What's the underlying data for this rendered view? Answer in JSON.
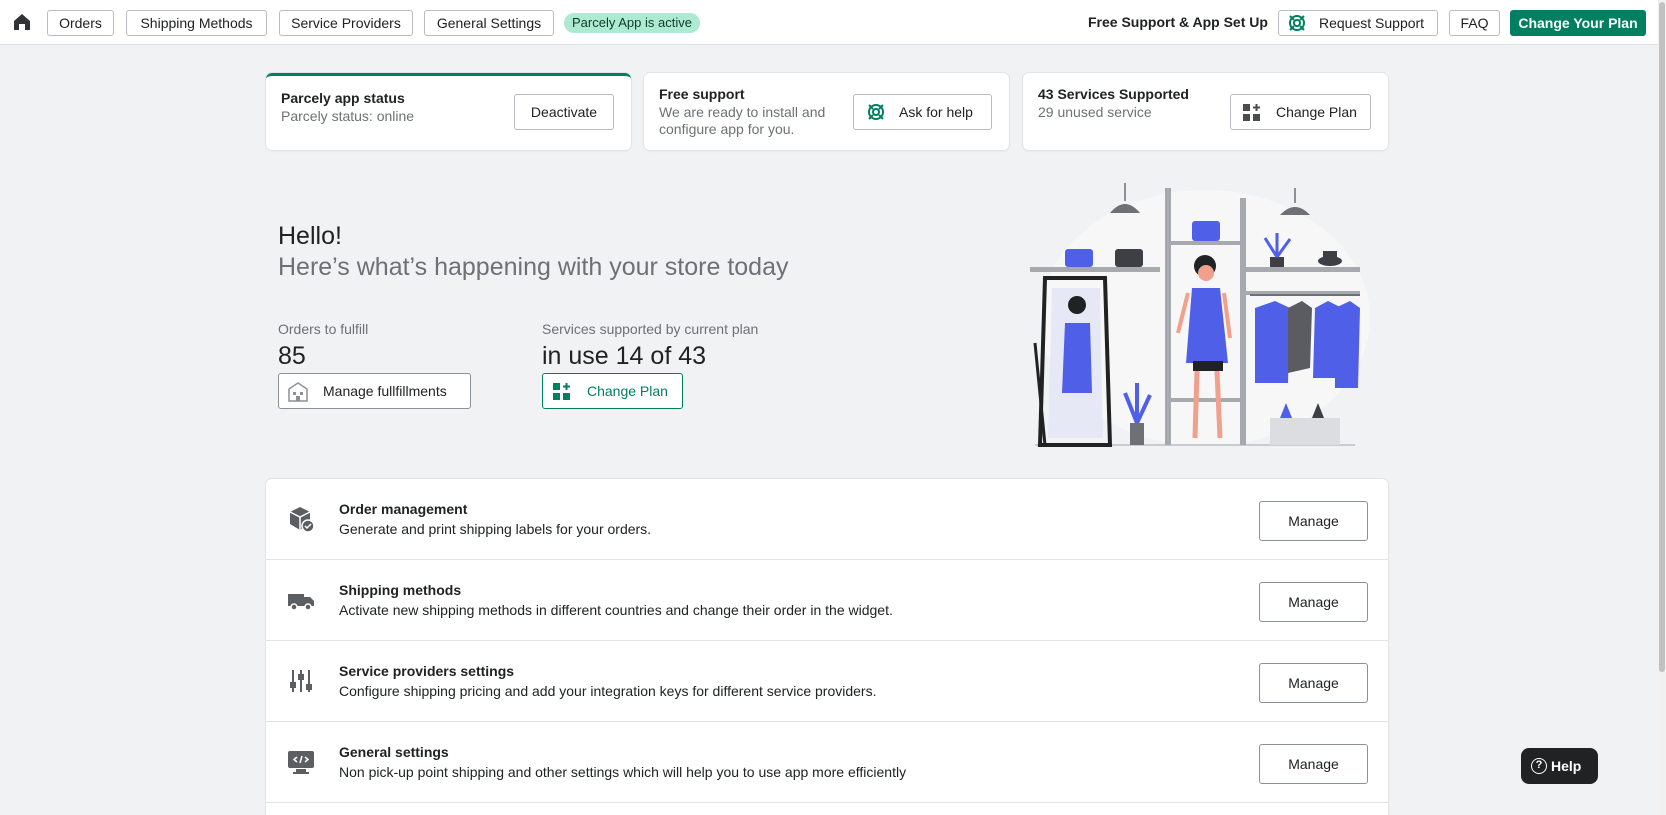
{
  "topbar": {
    "nav": [
      "Orders",
      "Shipping Methods",
      "Service Providers",
      "General Settings"
    ],
    "status_badge": "Parcely App is active",
    "support_label": "Free Support & App Set Up",
    "request_support": "Request Support",
    "faq": "FAQ",
    "change_plan": "Change Your Plan"
  },
  "cards": {
    "status": {
      "title": "Parcely app status",
      "subtitle": "Parcely status: online",
      "button": "Deactivate"
    },
    "support": {
      "title": "Free support",
      "subtitle_line1": "We are ready to install and",
      "subtitle_line2": "configure app for you.",
      "button": "Ask for help"
    },
    "services": {
      "title": "43 Services Supported",
      "subtitle": "29 unused service",
      "button": "Change Plan"
    }
  },
  "hero": {
    "greeting": "Hello!",
    "subtitle": "Here’s what’s happening with your store today",
    "orders_label": "Orders to fulfill",
    "orders_value": "85",
    "orders_button": "Manage fullfillments",
    "services_label": "Services supported by current plan",
    "services_value": "in use 14 of 43",
    "services_button": "Change Plan"
  },
  "features": [
    {
      "title": "Order management",
      "desc": "Generate and print shipping labels for your orders.",
      "button": "Manage",
      "icon": "package-check-icon"
    },
    {
      "title": "Shipping methods",
      "desc": "Activate new shipping methods in different countries and change their order in the widget.",
      "button": "Manage",
      "icon": "truck-icon"
    },
    {
      "title": "Service providers settings",
      "desc": "Configure shipping pricing and add your integration keys for different service providers.",
      "button": "Manage",
      "icon": "sliders-icon"
    },
    {
      "title": "General settings",
      "desc": "Non pick-up point shipping and other settings which will help you to use app more efficiently",
      "button": "Manage",
      "icon": "monitor-code-icon"
    }
  ],
  "help": "Help",
  "colors": {
    "primary": "#008060",
    "badge_bg": "#aee9d1",
    "accent_blue": "#4f5fe8",
    "dark": "#202223"
  }
}
